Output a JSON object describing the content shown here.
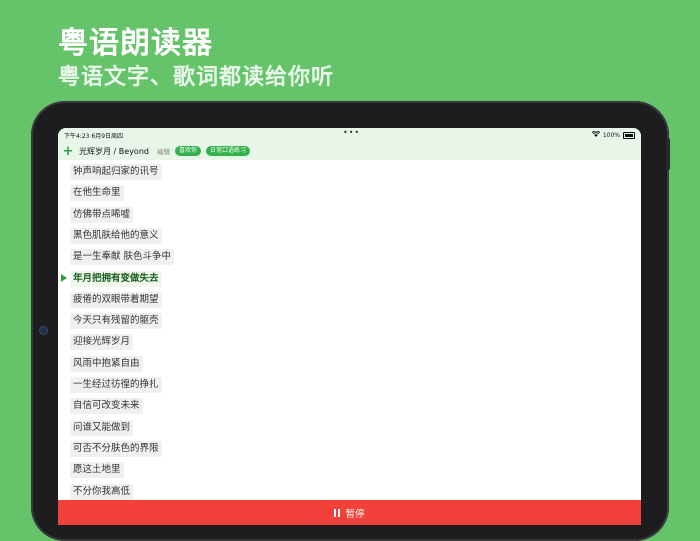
{
  "promo": {
    "title": "粤语朗读器",
    "subtitle": "粤语文字、歌词都读给你听"
  },
  "status_bar": {
    "time": "下午4:23  6月9日周四",
    "dots": "•••",
    "battery": "100%"
  },
  "toolbar": {
    "song_title": "光辉岁月 / Beyond",
    "edit_label": "编辑",
    "chips": [
      "喜欢你",
      "日常口语练习"
    ]
  },
  "lyrics": [
    "钟声响起归家的讯号",
    "在他生命里",
    "仿佛带点唏嘘",
    "黑色肌肤给他的意义",
    "是一生奉献 肤色斗争中",
    "年月把拥有变做失去",
    "疲倦的双眼带着期望",
    "今天只有残留的躯壳",
    "迎接光辉岁月",
    "风雨中抱紧自由",
    "一生经过彷徨的挣扎",
    "自信可改变未来",
    "问谁又能做到",
    "可否不分肤色的界限",
    "愿这土地里",
    "不分你我高低"
  ],
  "active_index": 5,
  "player": {
    "pause_label": "暂停"
  },
  "colors": {
    "background": "#65c46a",
    "accent": "#33b14a",
    "pause": "#f2413a"
  }
}
